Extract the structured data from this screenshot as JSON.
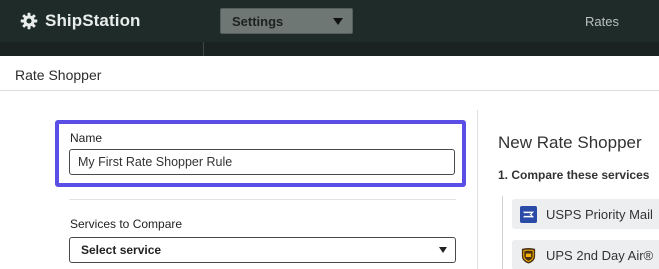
{
  "app": {
    "brand": "ShipStation",
    "settings_label": "Settings",
    "nav_rates": "Rates"
  },
  "modal": {
    "title": "Rate Shopper",
    "name_label": "Name",
    "name_value": "My First Rate Shopper Rule",
    "services_label": "Services to Compare",
    "services_selected": "Select service"
  },
  "panel": {
    "title": "New Rate Shopper",
    "step1": "1. Compare these services",
    "services": [
      {
        "name": "USPS Priority Mail",
        "icon": "usps-icon"
      },
      {
        "name": "UPS 2nd Day Air®",
        "icon": "ups-icon"
      }
    ]
  },
  "colors": {
    "topbar": "#1e2b28",
    "highlight": "#5b4ee6",
    "service_card": "#eceeef"
  }
}
